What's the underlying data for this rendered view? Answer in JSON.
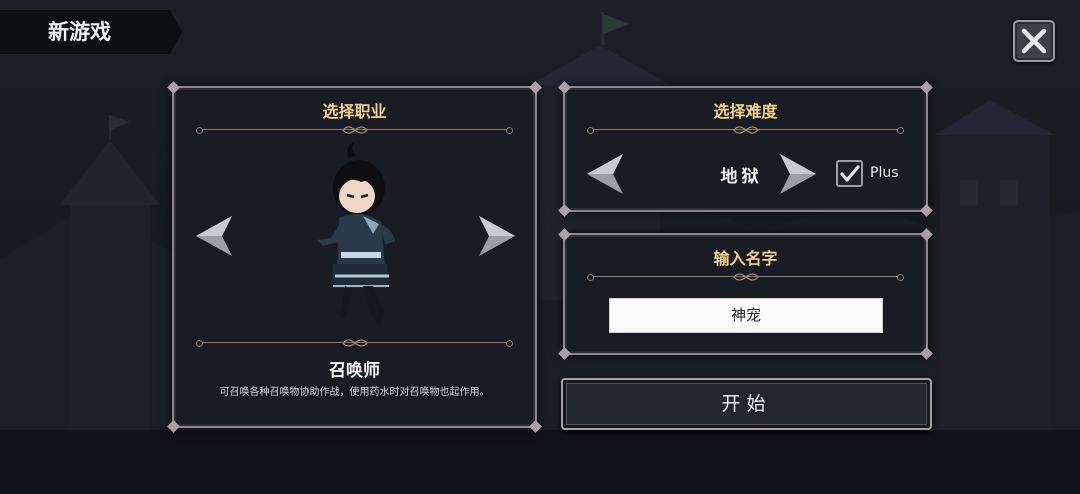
{
  "header": {
    "title": "新游戏"
  },
  "class_panel": {
    "heading": "选择职业",
    "character_name": "召唤师",
    "character_description": "可召唤各种召唤物协助作战，使用药水时对召唤物也起作用。"
  },
  "difficulty_panel": {
    "heading": "选择难度",
    "value": "地狱",
    "plus_checked": true,
    "plus_label": "Plus"
  },
  "name_panel": {
    "heading": "输入名字",
    "name_value": "神宠"
  },
  "start_button": {
    "label": "开始"
  },
  "icons": {
    "close": "close-icon",
    "prev": "arrow-left-icon",
    "next": "arrow-right-icon",
    "check": "checkmark-icon"
  },
  "colors": {
    "heading_gold": "#f3d18d",
    "panel_border": "#8c8893",
    "panel_bg": "#1a1c24"
  }
}
